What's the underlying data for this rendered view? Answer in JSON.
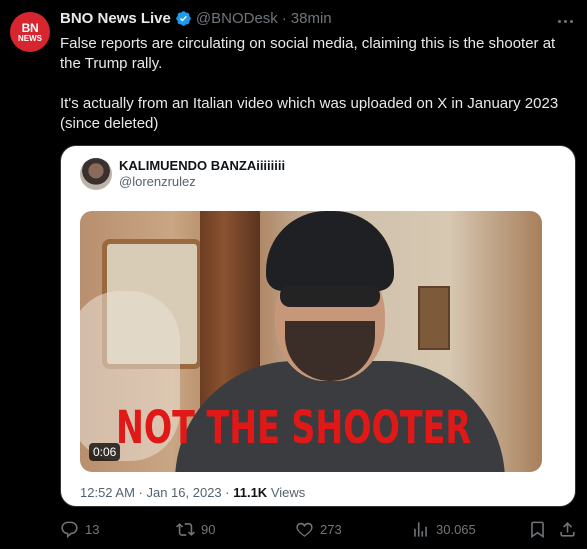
{
  "post": {
    "avatar_line1": "BN",
    "avatar_line2": "NEWS",
    "author_name": "BNO News Live",
    "author_handle": "@BNODesk",
    "separator": "·",
    "time": "38min",
    "text_paragraph1": "False reports are circulating on social media, claiming this is the shooter at the Trump rally.",
    "text_paragraph2": "It's actually from an Italian video which was uploaded on X in January 2023 (since deleted)"
  },
  "quoted": {
    "author_name": "KALIMUENDO BANZAiiiiiiii",
    "author_handle": "@lorenzrulez",
    "overlay_text": "NOT THE SHOOTER",
    "duration": "0:06",
    "timestamp": "12:52 AM · Jan 16, 2023 · ",
    "views_count": "11.1K",
    "views_label": " Views"
  },
  "actions": {
    "replies": "13",
    "retweets": "90",
    "likes": "273",
    "views": "30.065"
  },
  "icons": [
    "verified-badge-icon",
    "more-icon",
    "reply-icon",
    "retweet-icon",
    "like-icon",
    "views-icon",
    "bookmark-icon",
    "share-icon"
  ],
  "colors": {
    "background": "#000000",
    "text": "#e7e9ea",
    "muted": "#71767b",
    "verified": "#1d9bf0",
    "avatar": "#d7262f",
    "overlay": "#e11818"
  }
}
